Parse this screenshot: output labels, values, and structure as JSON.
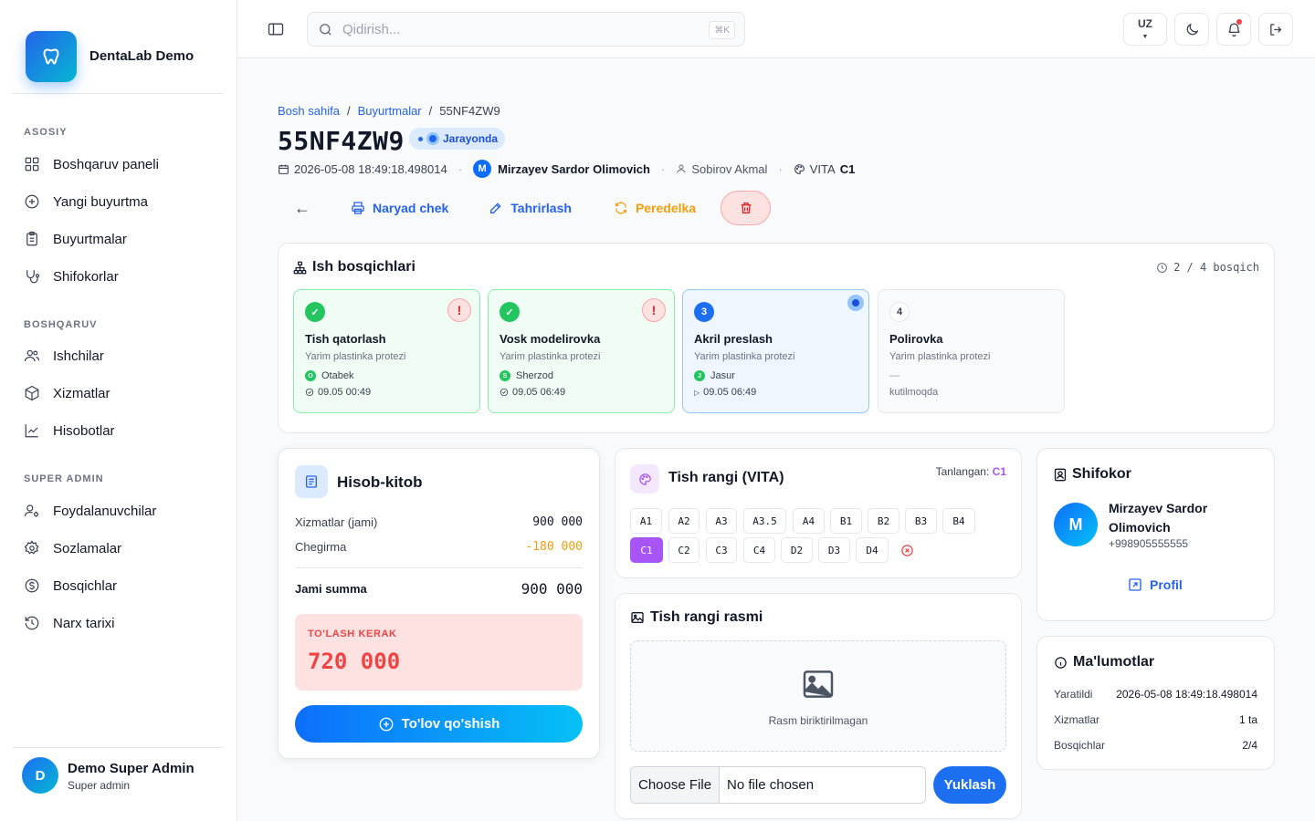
{
  "app": {
    "name": "DentaLab Demo"
  },
  "sidebar": {
    "sections": [
      {
        "label": "ASOSIY",
        "items": [
          {
            "label": "Boshqaruv paneli",
            "icon": "dashboard-icon"
          },
          {
            "label": "Yangi buyurtma",
            "icon": "plus-circle-icon"
          },
          {
            "label": "Buyurtmalar",
            "icon": "clipboard-icon"
          },
          {
            "label": "Shifokorlar",
            "icon": "stethoscope-icon"
          }
        ]
      },
      {
        "label": "BOSHQARUV",
        "items": [
          {
            "label": "Ishchilar",
            "icon": "users-icon"
          },
          {
            "label": "Xizmatlar",
            "icon": "box-icon"
          },
          {
            "label": "Hisobotlar",
            "icon": "chart-line-icon"
          }
        ]
      },
      {
        "label": "SUPER ADMIN",
        "items": [
          {
            "label": "Foydalanuvchilar",
            "icon": "user-cog-icon"
          },
          {
            "label": "Sozlamalar",
            "icon": "gear-icon"
          },
          {
            "label": "Bosqichlar",
            "icon": "dollar-circle-icon"
          },
          {
            "label": "Narx tarixi",
            "icon": "history-icon"
          }
        ]
      }
    ],
    "user": {
      "initial": "D",
      "name": "Demo Super Admin",
      "role": "Super admin"
    }
  },
  "topbar": {
    "search_placeholder": "Qidirish...",
    "shortcut": "⌘K",
    "lang": "UZ"
  },
  "breadcrumb": {
    "home": "Bosh sahifa",
    "orders": "Buyurtmalar",
    "current": "55NF4ZW9"
  },
  "order": {
    "code": "55NF4ZW9",
    "status": "Jarayonda",
    "created": "2026-05-08 18:49:18.498014",
    "doctor_initial": "M",
    "doctor": "Mirzayev Sardor Olimovich",
    "patient": "Sobirov Akmal",
    "shade_system": "VITA",
    "shade": "C1"
  },
  "actions": {
    "back": "←",
    "print": "Naryad chek",
    "edit": "Tahrirlash",
    "redo": "Peredelka"
  },
  "stages": {
    "title": "Ish bosqichlari",
    "progress": "2 / 4 bosqich",
    "items": [
      {
        "state": "done",
        "num": "✓",
        "name": "Tish qatorlash",
        "sub": "Yarim plastinka protezi",
        "worker_initial": "O",
        "worker": "Otabek",
        "time": "09.05 00:49",
        "flag": "!"
      },
      {
        "state": "done",
        "num": "✓",
        "name": "Vosk modelirovka",
        "sub": "Yarim plastinka protezi",
        "worker_initial": "S",
        "worker": "Sherzod",
        "time": "09.05 06:49",
        "flag": "!"
      },
      {
        "state": "active",
        "num": "3",
        "name": "Akril preslash",
        "sub": "Yarim plastinka protezi",
        "worker_initial": "J",
        "worker": "Jasur",
        "time": "09.05 06:49"
      },
      {
        "state": "pending",
        "num": "4",
        "name": "Polirovka",
        "sub": "Yarim plastinka protezi",
        "worker": "—",
        "time": "kutilmoqda"
      }
    ]
  },
  "billing": {
    "title": "Hisob-kitob",
    "services_label": "Xizmatlar (jami)",
    "services_value": "900 000",
    "discount_label": "Chegirma",
    "discount_value": "-180 000",
    "total_label": "Jami summa",
    "total_value": "900 000",
    "due_label": "TO'LASH KERAK",
    "due_value": "720 000",
    "pay_button": "To'lov qo'shish"
  },
  "shade": {
    "title": "Tish rangi (VITA)",
    "selected_label": "Tanlangan:",
    "selected_value": "C1",
    "row1": [
      "A1",
      "A2",
      "A3",
      "A3.5",
      "A4",
      "B1",
      "B2",
      "B3",
      "B4"
    ],
    "row2": [
      "C1",
      "C2",
      "C3",
      "C4",
      "D2",
      "D3",
      "D4"
    ],
    "accent": "#a855f7"
  },
  "shade_photo": {
    "title": "Tish rangi rasmi",
    "empty": "Rasm biriktirilmagan",
    "choose": "Choose File",
    "no_file": "No file chosen",
    "upload": "Yuklash"
  },
  "doctor_card": {
    "title": "Shifokor",
    "initial": "M",
    "name": "Mirzayev Sardor Olimovich",
    "phone": "+998905555555",
    "profile": "Profil"
  },
  "info": {
    "title": "Ma'lumotlar",
    "rows": [
      {
        "label": "Yaratildi",
        "value": "2026-05-08 18:49:18.498014"
      },
      {
        "label": "Xizmatlar",
        "value": "1 ta"
      },
      {
        "label": "Bosqichlar",
        "value": "2/4"
      }
    ]
  },
  "colors": {
    "primary": "#2563eb",
    "success": "#22c55e",
    "warning": "#f59e0b",
    "danger": "#dc2626"
  }
}
